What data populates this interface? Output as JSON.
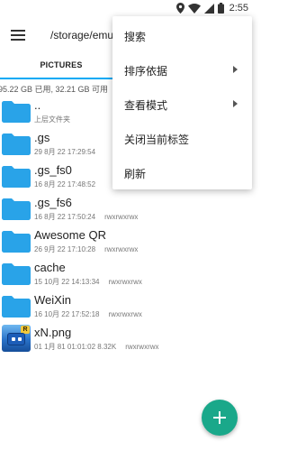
{
  "status_bar": {
    "time": "2:55",
    "icons": [
      "location-icon",
      "wifi-icon",
      "signal-icon",
      "battery-icon"
    ]
  },
  "toolbar": {
    "path": "/storage/emul",
    "menu_icon": "hamburger-menu-icon"
  },
  "tabs": [
    {
      "label": "PICTURES",
      "active": true
    }
  ],
  "storage_info": "95.22 GB 已用, 32.21 GB 可用",
  "files": [
    {
      "name": "..",
      "meta": "上层文件夹",
      "perm": "",
      "type": "folder"
    },
    {
      "name": ".gs",
      "meta": "29 8月 22 17:29:54",
      "perm": "",
      "type": "folder"
    },
    {
      "name": ".gs_fs0",
      "meta": "16 8月 22 17:48:52",
      "perm": "",
      "type": "folder"
    },
    {
      "name": ".gs_fs6",
      "meta": "16 8月 22 17:50:24",
      "perm": "rwxrwxrwx",
      "type": "folder"
    },
    {
      "name": "Awesome QR",
      "meta": "26 9月 22 17:10:28",
      "perm": "rwxrwxrwx",
      "type": "folder"
    },
    {
      "name": "cache",
      "meta": "15 10月 22 14:13:34",
      "perm": "rwxrwxrwx",
      "type": "folder"
    },
    {
      "name": "WeiXin",
      "meta": "16 10月 22 17:52:18",
      "perm": "rwxrwxrwx",
      "type": "folder"
    },
    {
      "name": "xN.png",
      "meta": "01 1月 81 01:01:02 8.32K",
      "perm": "rwxrwxrwx",
      "type": "image"
    }
  ],
  "overflow_menu": {
    "items": [
      {
        "label": "搜索",
        "has_submenu": false
      },
      {
        "label": "排序依据",
        "has_submenu": true
      },
      {
        "label": "查看模式",
        "has_submenu": true
      },
      {
        "label": "关闭当前标签",
        "has_submenu": false
      },
      {
        "label": "刷新",
        "has_submenu": false
      }
    ]
  },
  "fab": {
    "icon": "plus-icon"
  },
  "colors": {
    "accent": "#03a9f4",
    "folder": "#29a3e8",
    "fab": "#1aa88a"
  }
}
